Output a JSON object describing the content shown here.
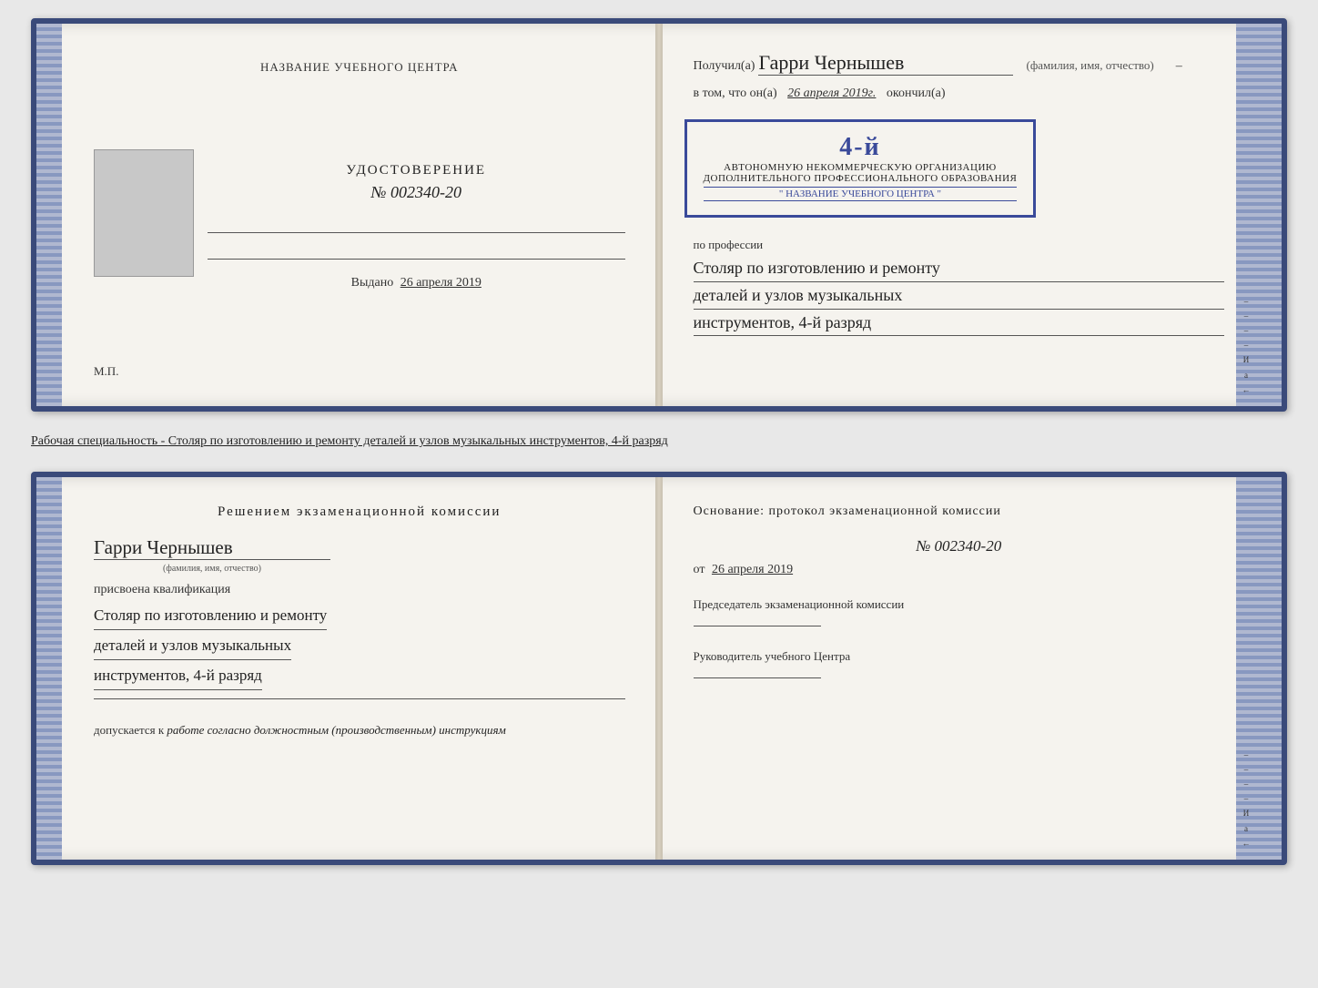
{
  "top": {
    "left": {
      "org_name": "НАЗВАНИЕ УЧЕБНОГО ЦЕНТРА",
      "cert_title": "УДОСТОВЕРЕНИЕ",
      "cert_number": "№ 002340-20",
      "issued_label": "Выдано",
      "issued_date": "26 апреля 2019",
      "mp": "М.П."
    },
    "right": {
      "recipient_prefix": "Получил(а)",
      "recipient_name": "Гарри Чернышев",
      "fio_hint": "(фамилия, имя, отчество)",
      "date_prefix": "в том, что он(а)",
      "date_value": "26 апреля 2019г.",
      "date_suffix": "окончил(а)",
      "stamp_rank": "4-й",
      "stamp_line1": "АВТОНОМНУЮ НЕКОММЕРЧЕСКУЮ ОРГАНИЗАЦИЮ",
      "stamp_line2": "ДОПОЛНИТЕЛЬНОГО ПРОФЕССИОНАЛЬНОГО ОБРАЗОВАНИЯ",
      "stamp_org_name": "\" НАЗВАНИЕ УЧЕБНОГО ЦЕНТРА \"",
      "profession_label": "по профессии",
      "profession_line1": "Столяр по изготовлению и ремонту",
      "profession_line2": "деталей и узлов музыкальных",
      "profession_line3": "инструментов, 4-й разряд"
    }
  },
  "specialty_label": "Рабочая специальность - Столяр по изготовлению и ремонту деталей и узлов музыкальных инструментов, 4-й разряд",
  "bottom": {
    "left": {
      "decision_title": "Решением  экзаменационной  комиссии",
      "person_name": "Гарри Чернышев",
      "fio_hint": "(фамилия, имя, отчество)",
      "qualification_prefix": "присвоена квалификация",
      "qualification_line1": "Столяр по изготовлению и ремонту",
      "qualification_line2": "деталей и узлов музыкальных",
      "qualification_line3": "инструментов, 4-й разряд",
      "allowed_prefix": "допускается к",
      "allowed_text": "работе согласно должностным (производственным) инструкциям"
    },
    "right": {
      "basis_title": "Основание: протокол экзаменационной  комиссии",
      "basis_number": "№  002340-20",
      "basis_date_prefix": "от",
      "basis_date": "26 апреля 2019",
      "chairman_label": "Председатель экзаменационной комиссии",
      "director_label": "Руководитель учебного Центра"
    }
  },
  "side_chars": [
    "И",
    "а",
    "←",
    "–",
    "–",
    "–",
    "–"
  ]
}
